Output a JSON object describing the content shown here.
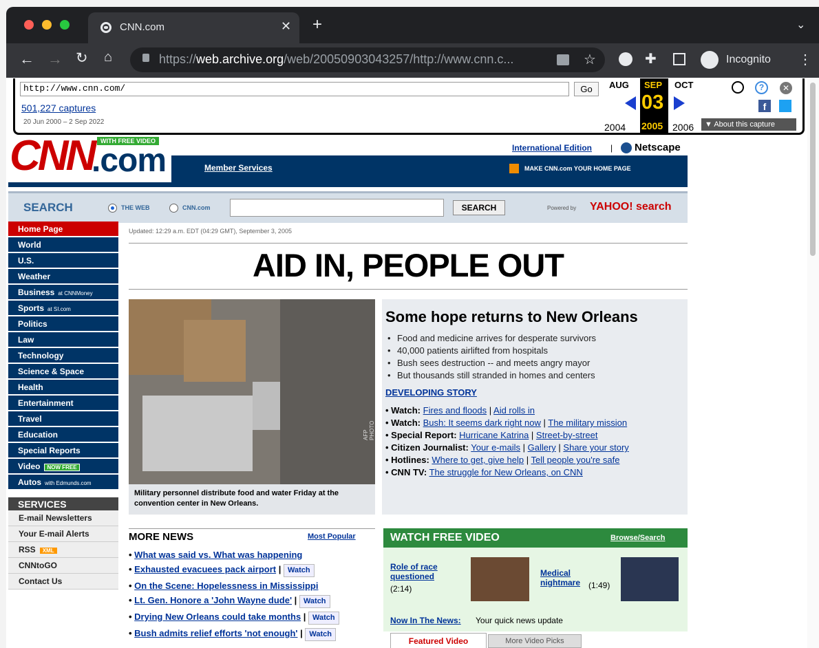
{
  "browser": {
    "tab_title": "CNN.com",
    "url_prefix": "https://",
    "url_domain": "web.archive.org",
    "url_path": "/web/20050903043257/http://www.cnn.c...",
    "incognito": "Incognito"
  },
  "wayback": {
    "url": "http://www.cnn.com/",
    "go": "Go",
    "captures": "501,227 captures",
    "range": "20 Jun 2000 – 2 Sep 2022",
    "prev_month": "AUG",
    "cur_month": "SEP",
    "next_month": "OCT",
    "day": "03",
    "prev_year": "2004",
    "cur_year": "2005",
    "next_year": "2006",
    "about": "▼ About this capture"
  },
  "header": {
    "logo_cnn": "CNN",
    "logo_com": ".com",
    "free_video": "WITH FREE VIDEO",
    "intl": "International Edition",
    "sep": "|",
    "netscape": "Netscape",
    "member": "Member Services",
    "make_home": "MAKE CNN.com YOUR HOME PAGE"
  },
  "search": {
    "title": "SEARCH",
    "opt_web": "THE WEB",
    "opt_cnn": "CNN.com",
    "button": "SEARCH",
    "powered": "Powered by",
    "yahoo": "YAHOO! search"
  },
  "nav": [
    "Home Page",
    "World",
    "U.S.",
    "Weather",
    "Business",
    "Sports",
    "Politics",
    "Law",
    "Technology",
    "Science & Space",
    "Health",
    "Entertainment",
    "Travel",
    "Education",
    "Special Reports",
    "Video",
    "Autos"
  ],
  "nav_suffix": {
    "business": "at CNNMoney",
    "sports": "at SI.com",
    "video": "NOW FREE",
    "autos": "with Edmunds.com"
  },
  "services": {
    "title": "SERVICES",
    "items": [
      "E-mail Newsletters",
      "Your E-mail Alerts",
      "RSS",
      "CNNtoGO",
      "Contact Us"
    ],
    "rss_badge": "XML"
  },
  "main": {
    "updated": "Updated: 12:29 a.m. EDT (04:29 GMT), September 3, 2005",
    "headline": "AID IN, PEOPLE OUT",
    "story_title": "Some hope returns to New Orleans",
    "bullets": [
      "Food and medicine arrives for desperate survivors",
      "40,000 patients airlifted from hospitals",
      "Bush sees destruction -- and meets angry mayor",
      "But thousands still stranded in homes and centers"
    ],
    "developing": "DEVELOPING STORY",
    "photo_credit": "AFP PHOTO",
    "caption": "Military personnel distribute food and water Friday at the convention center in New Orleans."
  },
  "dev_lines": [
    {
      "label": "• Watch:",
      "links": [
        "Fires and floods",
        "Aid rolls in"
      ]
    },
    {
      "label": "• Watch:",
      "links": [
        "Bush: It seems dark right now",
        "The military mission"
      ]
    },
    {
      "label": "• Special Report:",
      "links": [
        "Hurricane Katrina",
        "Street-by-street"
      ]
    },
    {
      "label": "• Citizen Journalist:",
      "links": [
        "Your e-mails",
        "Gallery",
        "Share your story"
      ]
    },
    {
      "label": "• Hotlines:",
      "links": [
        "Where to get, give help",
        "Tell people you're safe"
      ]
    },
    {
      "label": "• CNN TV:",
      "links": [
        "The struggle for New Orleans, on CNN"
      ]
    }
  ],
  "more_news": {
    "title": "MORE NEWS",
    "most_popular": "Most Popular",
    "watch": "Watch",
    "items": [
      "What was said vs. What was happening",
      "Exhausted evacuees pack airport",
      "On the Scene: Hopelessness in Mississippi",
      "Lt. Gen. Honore a 'John Wayne dude'",
      "Drying New Orleans could take months",
      "Bush admits relief efforts 'not enough'"
    ]
  },
  "video": {
    "title": "WATCH FREE VIDEO",
    "browse": "Browse/Search",
    "v1_title": "Role of race questioned",
    "v1_time": "(2:14)",
    "v2_title": "Medical nightmare",
    "v2_time": "(1:49)",
    "now_label": "Now In The News:",
    "now_text": "Your quick news update",
    "tab1": "Featured Video",
    "tab2": "More Video Picks"
  }
}
